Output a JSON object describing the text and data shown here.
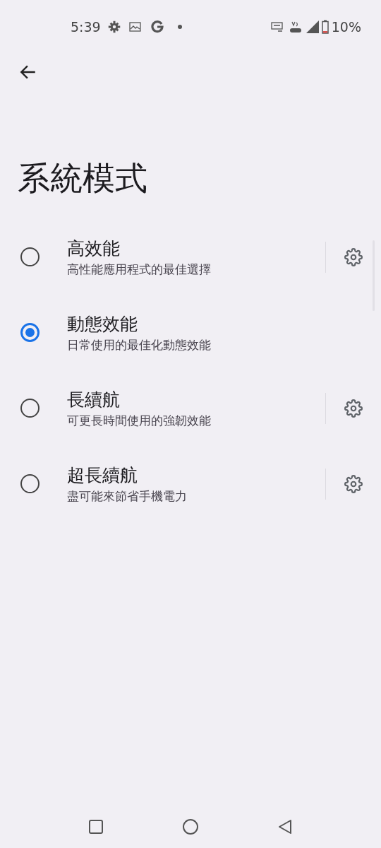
{
  "status_bar": {
    "time": "5:39",
    "battery": "10%"
  },
  "title": "系統模式",
  "modes": [
    {
      "title": "高效能",
      "subtitle": "高性能應用程式的最佳選擇",
      "selected": false,
      "has_settings": true
    },
    {
      "title": "動態效能",
      "subtitle": "日常使用的最佳化動態效能",
      "selected": true,
      "has_settings": false
    },
    {
      "title": "長續航",
      "subtitle": "可更長時間使用的強韌效能",
      "selected": false,
      "has_settings": true
    },
    {
      "title": "超長續航",
      "subtitle": "盡可能來節省手機電力",
      "selected": false,
      "has_settings": true
    }
  ]
}
